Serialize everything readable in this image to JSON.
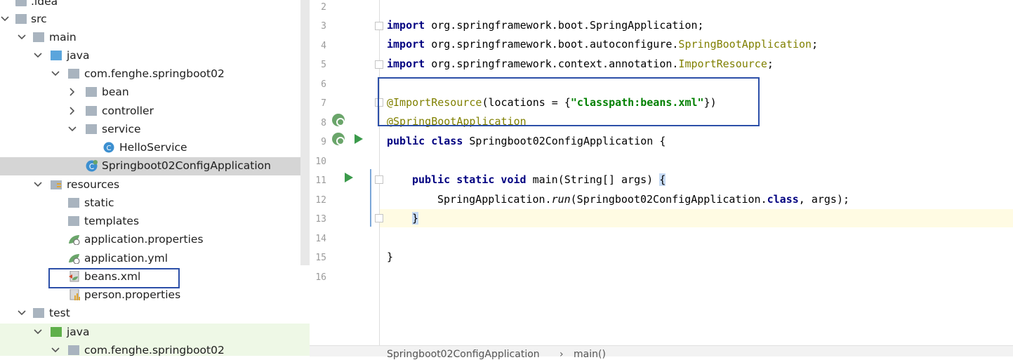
{
  "tree": {
    "items": [
      {
        "label": ".idea",
        "expanded": false
      },
      {
        "label": "src",
        "expanded": true
      },
      {
        "label": "main",
        "expanded": true
      },
      {
        "label": "java",
        "expanded": true
      },
      {
        "label": "com.fenghe.springboot02",
        "expanded": true
      },
      {
        "label": "bean",
        "expanded": false
      },
      {
        "label": "controller",
        "expanded": false
      },
      {
        "label": "service",
        "expanded": true
      },
      {
        "label": "HelloService"
      },
      {
        "label": "Springboot02ConfigApplication",
        "selected": true
      },
      {
        "label": "resources",
        "expanded": true
      },
      {
        "label": "static"
      },
      {
        "label": "templates"
      },
      {
        "label": "application.properties"
      },
      {
        "label": "application.yml"
      },
      {
        "label": "beans.xml"
      },
      {
        "label": "person.properties"
      },
      {
        "label": "test",
        "expanded": true
      },
      {
        "label": "java",
        "expanded": true
      },
      {
        "label": "com.fenghe.springboot02",
        "expanded": true
      }
    ]
  },
  "editor": {
    "line_numbers": [
      "2",
      "3",
      "4",
      "5",
      "6",
      "7",
      "8",
      "9",
      "10",
      "11",
      "12",
      "13",
      "14",
      "15",
      "16"
    ],
    "code": {
      "l3_kw": "import",
      "l3_rest": " org.springframework.boot.SpringApplication;",
      "l4_kw": "import",
      "l4_pkg": " org.springframework.boot.autoconfigure.",
      "l4_cls": "SpringBootApplication",
      "l4_end": ";",
      "l5_kw": "import",
      "l5_pkg": " org.springframework.context.annotation.",
      "l5_cls": "ImportResource",
      "l5_end": ";",
      "l7_ann": "@ImportResource",
      "l7_mid": "(locations = {",
      "l7_str": "\"classpath:beans.xml\"",
      "l7_end": "})",
      "l8_ann": "@SpringBootApplication",
      "l9_kw": "public class",
      "l9_rest": " Springboot02ConfigApplication {",
      "l11_kw": "public static void",
      "l11_rest": " main(String[] args) ",
      "l11_brace": "{",
      "l12_a": "SpringApplication.",
      "l12_run": "run",
      "l12_b": "(Springboot02ConfigApplication.",
      "l12_cls": "class",
      "l12_c": ", args);",
      "l13_brace": "}",
      "l15_brace": "}"
    }
  },
  "breadcrumb": {
    "class_name": "Springboot02ConfigApplication",
    "separator": "›",
    "method": "main()"
  },
  "colors": {
    "keyword": "#000080",
    "annotation": "#808000",
    "string": "#008000",
    "highlight_box": "#2c4fa8"
  }
}
